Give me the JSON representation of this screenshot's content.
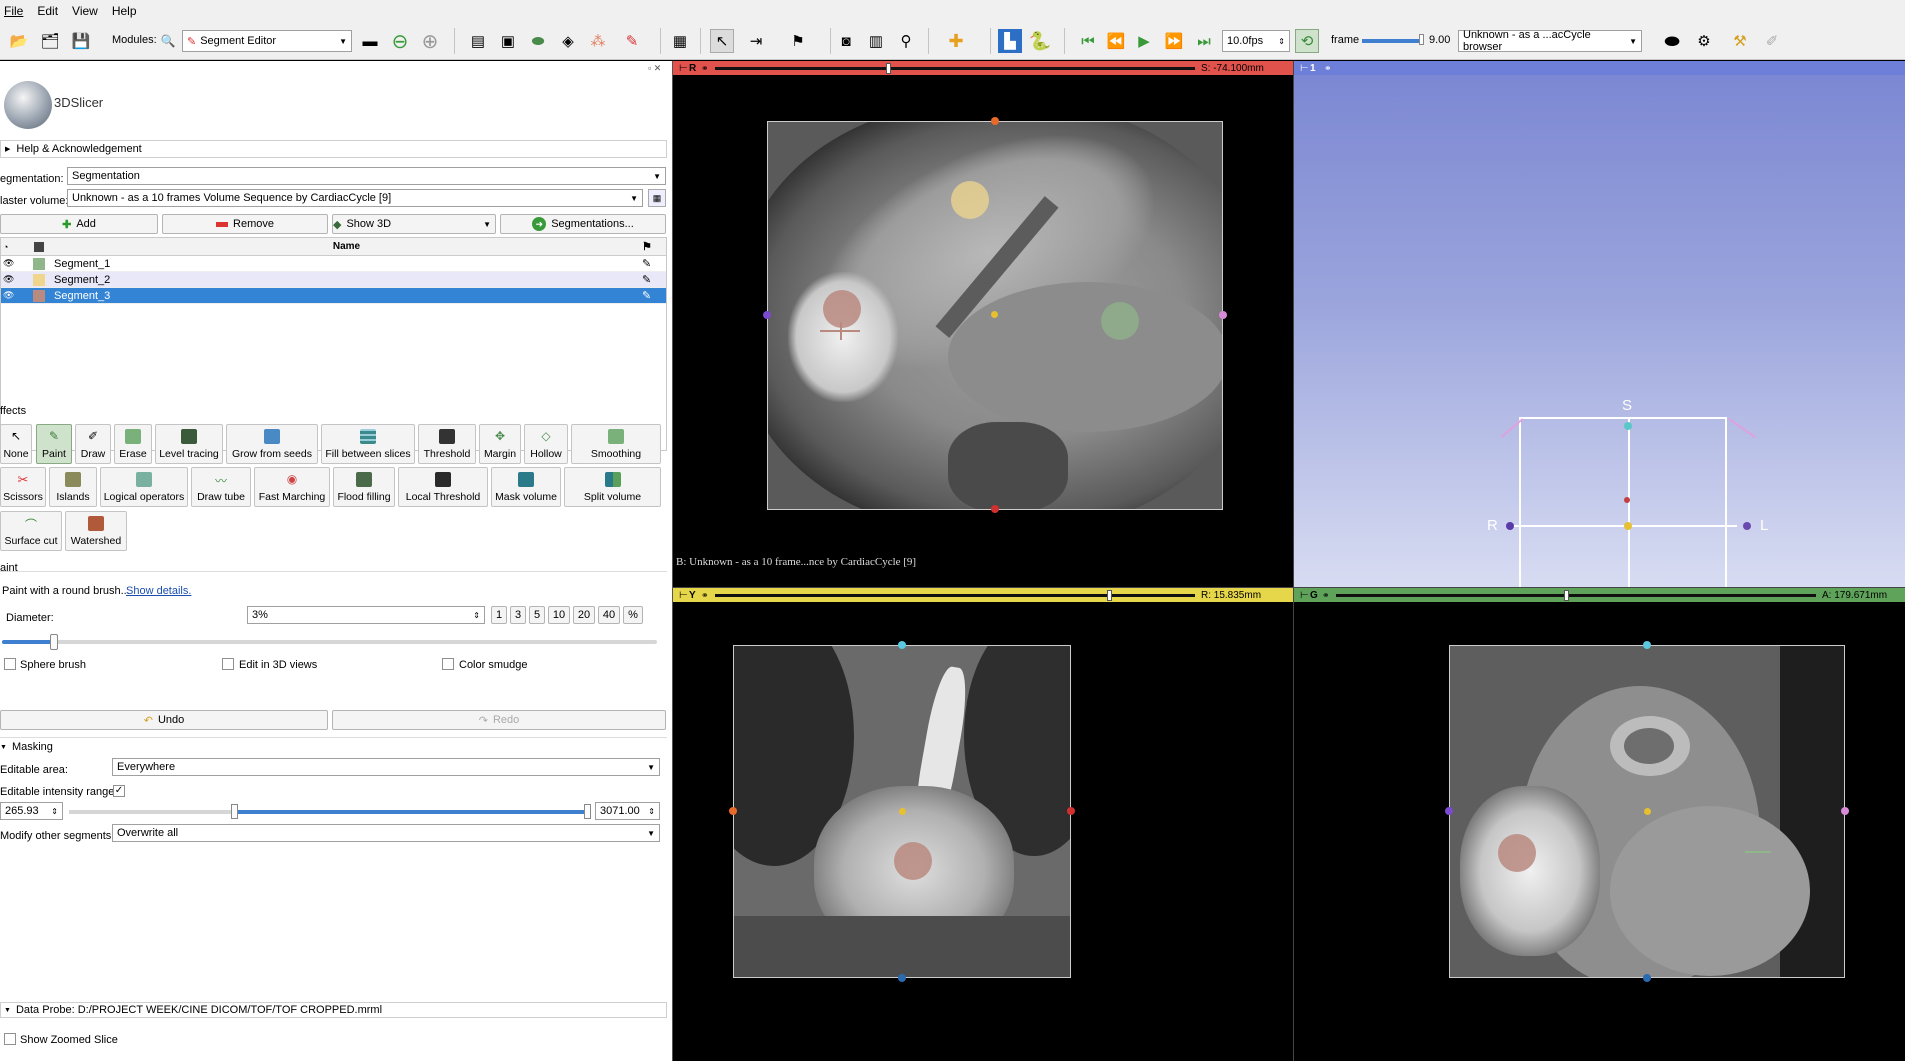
{
  "menu": [
    "File",
    "Edit",
    "View",
    "Help"
  ],
  "toolbar": {
    "modules_label": "Modules:",
    "module_selected": "Segment Editor",
    "fps": "10.0fps",
    "frame_label": "frame",
    "frame_value": "9.00",
    "browser_selected": "Unknown - as a ...acCycle browser"
  },
  "logo": "3DSlicer",
  "help_section": "Help & Acknowledgement",
  "segmentation": {
    "label": "egmentation:",
    "value": "Segmentation"
  },
  "master_volume": {
    "label": "laster volume:",
    "value": "Unknown - as a 10 frames Volume Sequence by CardiacCycle [9]"
  },
  "seg_buttons": {
    "add": "Add",
    "remove": "Remove",
    "show3d": "Show 3D",
    "segmentations": "Segmentations..."
  },
  "table": {
    "header_name": "Name",
    "rows": [
      {
        "name": "Segment_1",
        "color": "#8fb78a"
      },
      {
        "name": "Segment_2",
        "color": "#f0d68c"
      },
      {
        "name": "Segment_3",
        "color": "#b98a80"
      }
    ]
  },
  "effects_label": "ffects",
  "effects": {
    "none": "None",
    "paint": "Paint",
    "draw": "Draw",
    "erase": "Erase",
    "level_tracing": "Level tracing",
    "grow_from_seeds": "Grow from seeds",
    "fill_between": "Fill between slices",
    "threshold": "Threshold",
    "margin": "Margin",
    "hollow": "Hollow",
    "smoothing": "Smoothing",
    "scissors": "Scissors",
    "islands": "Islands",
    "logical_operators": "Logical operators",
    "draw_tube": "Draw tube",
    "fast_marching": "Fast Marching",
    "flood_filling": "Flood filling",
    "local_threshold": "Local Threshold",
    "mask_volume": "Mask volume",
    "split_volume": "Split volume",
    "surface_cut": "Surface cut",
    "watershed": "Watershed"
  },
  "paint": {
    "section": "aint",
    "desc": "Paint with a round brush...",
    "show_details": "Show details.",
    "diameter_label": "Diameter:",
    "diameter_value": "3%",
    "presets": [
      "1",
      "3",
      "5",
      "10",
      "20",
      "40",
      "%"
    ],
    "sphere_brush": "Sphere brush",
    "edit_3d": "Edit in 3D views",
    "color_smudge": "Color smudge",
    "diameter_slider_fraction": 0.08
  },
  "undo": "Undo",
  "redo": "Redo",
  "masking": {
    "section": "Masking",
    "editable_area_label": "Editable area:",
    "editable_area": "Everywhere",
    "intensity_label": "Editable intensity range:",
    "range_min": "265.93",
    "range_max": "3071.00",
    "modify_label": "Modify other segments:",
    "modify_value": "Overwrite all"
  },
  "data_probe": "Data Probe: D:/PROJECT WEEK/CINE DICOM/TOF/TOF CROPPED.mrml",
  "show_zoomed": "Show Zoomed Slice",
  "views": {
    "red": {
      "tag": "R",
      "offset": "S: -74.100mm",
      "label": "B: Unknown - as a 10 frame...nce by CardiacCycle [9]",
      "slider_fraction": 0.36,
      "color": "#e0524b"
    },
    "yellow": {
      "tag": "Y",
      "offset": "R: 15.835mm",
      "slider_fraction": 0.82,
      "color": "#e6d64a"
    },
    "green": {
      "tag": "G",
      "offset": "A: 179.671mm",
      "slider_fraction": 0.48,
      "color": "#5fa35a"
    },
    "threed": {
      "tag": "1",
      "S": "S",
      "R": "R",
      "L": "L",
      "color": "#6d7fd8"
    }
  },
  "colors": {
    "accent_selection": "#3384d4",
    "seg1": "#8fb78a",
    "seg2": "#f0d68c",
    "seg3": "#b98a80"
  }
}
